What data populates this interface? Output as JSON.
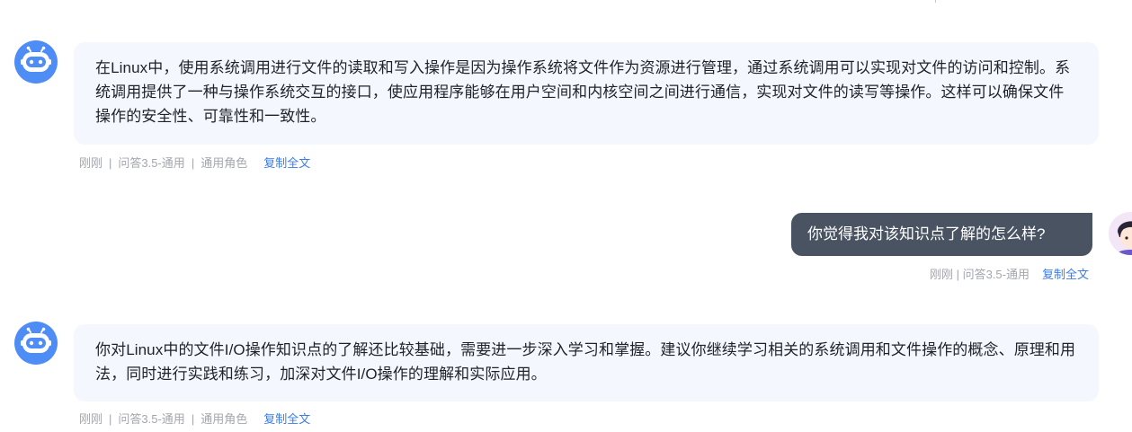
{
  "conversation": {
    "messages": [
      {
        "role": "assistant",
        "text": "在Linux中，使用系统调用进行文件的读取和写入操作是因为操作系统将文件作为资源进行管理，通过系统调用可以实现对文件的访问和控制。系统调用提供了一种与操作系统交互的接口，使应用程序能够在用户空间和内核空间之间进行通信，实现对文件的读写等操作。这样可以确保文件操作的安全性、可靠性和一致性。",
        "time": "刚刚",
        "model": "问答3.5-通用",
        "role_label": "通用角色",
        "copy_label": "复制全文"
      },
      {
        "role": "user",
        "text": "你觉得我对该知识点了解的怎么样?",
        "meta": "刚刚 | 问答3.5-通用",
        "copy_label": "复制全文"
      },
      {
        "role": "assistant",
        "text": "你对Linux中的文件I/O操作知识点的了解还比较基础，需要进一步深入学习和掌握。建议你继续学习相关的系统调用和文件操作的概念、原理和用法，同时进行实践和练习，加深对文件I/O操作的理解和实际应用。",
        "time": "刚刚",
        "model": "问答3.5-通用",
        "role_label": "通用角色",
        "copy_label": "复制全文"
      }
    ],
    "separator": "|"
  },
  "colors": {
    "bot_avatar": "#4e8cf6",
    "assistant_bubble": "#f4f7fd",
    "user_bubble": "#4a5361",
    "link": "#3a7de9",
    "meta_text": "#a3a6ad"
  },
  "icons": {
    "bot_avatar": "robot-icon",
    "user_avatar": "user-avatar-icon"
  }
}
